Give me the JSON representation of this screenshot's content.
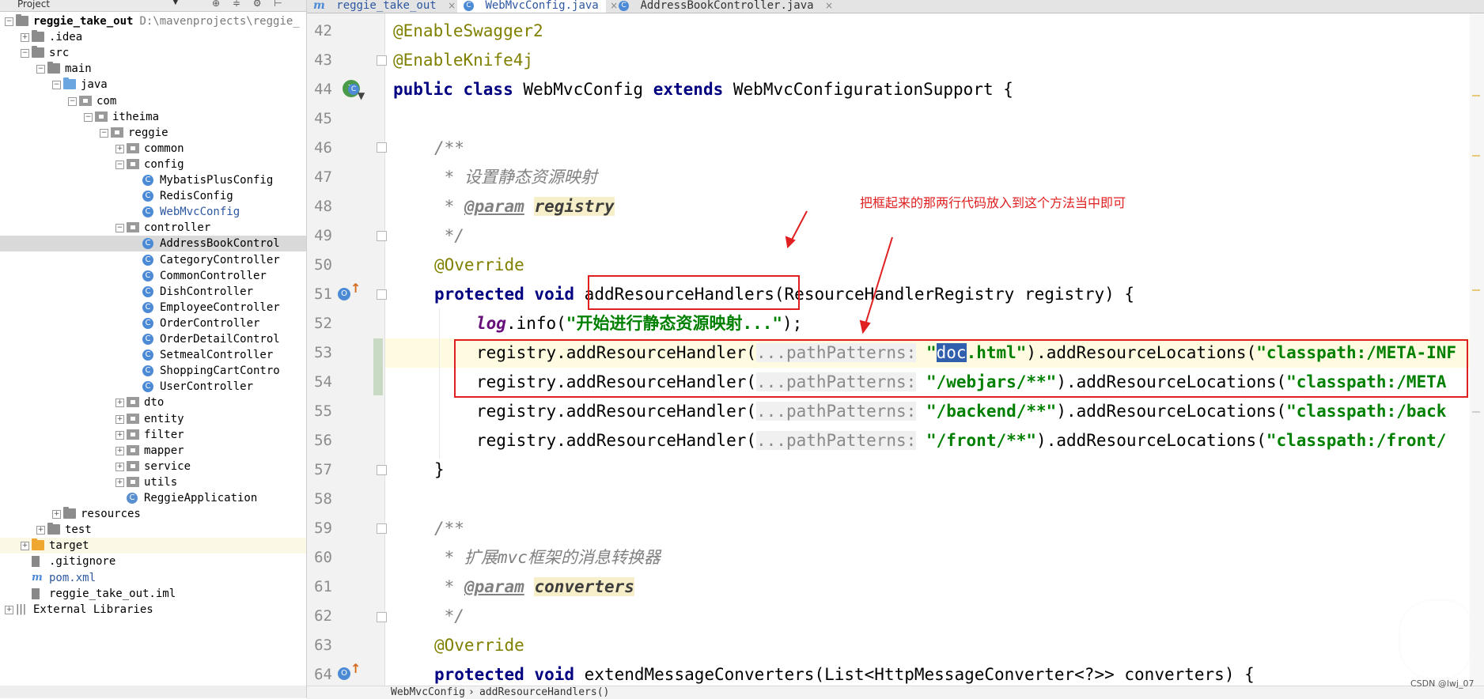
{
  "project_panel": {
    "title": "Project",
    "dropdown_glyph": "▼",
    "tools_glyphs": "⊕ ≑ ⚙ ⊢",
    "tree": [
      {
        "label": "reggie_take_out",
        "path": "D:\\mavenprojects\\reggie_",
        "bold": true,
        "icon": "folder-icon",
        "expander": "−",
        "depth": 0
      },
      {
        "label": ".idea",
        "icon": "folder-icon",
        "expander": "+",
        "depth": 1
      },
      {
        "label": "src",
        "icon": "folder-icon",
        "expander": "−",
        "depth": 1
      },
      {
        "label": "main",
        "icon": "folder-icon",
        "expander": "−",
        "depth": 2
      },
      {
        "label": "java",
        "icon": "source-folder-icon",
        "expander": "−",
        "depth": 3
      },
      {
        "label": "com",
        "icon": "package-icon",
        "expander": "−",
        "depth": 4
      },
      {
        "label": "itheima",
        "icon": "package-icon",
        "expander": "−",
        "depth": 5
      },
      {
        "label": "reggie",
        "icon": "package-icon",
        "expander": "−",
        "depth": 6
      },
      {
        "label": "common",
        "icon": "package-icon",
        "expander": "+",
        "depth": 7
      },
      {
        "label": "config",
        "icon": "package-icon",
        "expander": "−",
        "depth": 7
      },
      {
        "label": "MybatisPlusConfig",
        "icon": "class-icon",
        "depth": 8
      },
      {
        "label": "RedisConfig",
        "icon": "class-icon",
        "depth": 8
      },
      {
        "label": "WebMvcConfig",
        "icon": "class-icon",
        "depth": 8,
        "blue": true
      },
      {
        "label": "controller",
        "icon": "package-icon",
        "expander": "−",
        "depth": 7
      },
      {
        "label": "AddressBookControl",
        "icon": "class-icon",
        "depth": 8,
        "selected": true
      },
      {
        "label": "CategoryController",
        "icon": "class-icon",
        "depth": 8
      },
      {
        "label": "CommonController",
        "icon": "class-icon",
        "depth": 8
      },
      {
        "label": "DishController",
        "icon": "class-icon",
        "depth": 8
      },
      {
        "label": "EmployeeController",
        "icon": "class-icon",
        "depth": 8
      },
      {
        "label": "OrderController",
        "icon": "class-icon",
        "depth": 8
      },
      {
        "label": "OrderDetailControl",
        "icon": "class-icon",
        "depth": 8
      },
      {
        "label": "SetmealController",
        "icon": "class-icon",
        "depth": 8
      },
      {
        "label": "ShoppingCartContro",
        "icon": "class-icon",
        "depth": 8
      },
      {
        "label": "UserController",
        "icon": "class-icon",
        "depth": 8
      },
      {
        "label": "dto",
        "icon": "package-icon",
        "expander": "+",
        "depth": 7
      },
      {
        "label": "entity",
        "icon": "package-icon",
        "expander": "+",
        "depth": 7
      },
      {
        "label": "filter",
        "icon": "package-icon",
        "expander": "+",
        "depth": 7
      },
      {
        "label": "mapper",
        "icon": "package-icon",
        "expander": "+",
        "depth": 7
      },
      {
        "label": "service",
        "icon": "package-icon",
        "expander": "+",
        "depth": 7
      },
      {
        "label": "utils",
        "icon": "package-icon",
        "expander": "+",
        "depth": 7
      },
      {
        "label": "ReggieApplication",
        "icon": "spring-class-icon",
        "depth": 7
      },
      {
        "label": "resources",
        "icon": "folder-icon",
        "expander": "+",
        "depth": 3
      },
      {
        "label": "test",
        "icon": "folder-icon",
        "expander": "+",
        "depth": 2
      },
      {
        "label": "target",
        "icon": "excluded-folder-icon",
        "expander": "+",
        "depth": 1,
        "highlight": true
      },
      {
        "label": ".gitignore",
        "icon": "file-icon",
        "depth": 1
      },
      {
        "label": "pom.xml",
        "icon": "maven-icon",
        "depth": 1,
        "blue": true
      },
      {
        "label": "reggie_take_out.iml",
        "icon": "file-icon",
        "depth": 1
      },
      {
        "label": "External Libraries",
        "icon": "libraries-icon",
        "expander": "+",
        "depth": 0
      }
    ]
  },
  "tabs": [
    {
      "label": "reggie_take_out",
      "icon": "maven-icon",
      "close": "×",
      "active": false
    },
    {
      "label": "WebMvcConfig.java",
      "icon": "class-icon",
      "close": "×",
      "active": true
    },
    {
      "label": "AddressBookController.java",
      "icon": "class-icon",
      "close": "×",
      "active": false
    }
  ],
  "editor": {
    "line_numbers": [
      "42",
      "43",
      "44",
      "45",
      "46",
      "47",
      "48",
      "49",
      "50",
      "51",
      "52",
      "53",
      "54",
      "55",
      "56",
      "57",
      "58",
      "59",
      "60",
      "61",
      "62",
      "63",
      "64"
    ],
    "lines": {
      "l42": "@EnableSwagger2",
      "l43": "@EnableKnife4j",
      "l44_kw1": "public class",
      "l44_name": " WebMvcConfig ",
      "l44_kw2": "extends",
      "l44_rest": " WebMvcConfigurationSupport {",
      "l46": "/**",
      "l47": " * 设置静态资源映射",
      "l48_pre": " * ",
      "l48_tag": "@param",
      "l48_param": "registry",
      "l49": " */",
      "l50": "@Override",
      "l51_kw": "protected void",
      "l51_method": "addResourceHandlers",
      "l51_rest": "(ResourceHandlerRegistry registry) {",
      "l52_field": "log",
      "l52_mid": ".info(",
      "l52_str": "\"开始进行静态资源映射...\"",
      "l52_end": ");",
      "reg_prefix": "registry.addResourceHandler(",
      "hint": "...pathPatterns:",
      "l53_q": "\"",
      "l53_sel": "doc",
      "l53_str_rest": ".html\"",
      "l53_rest": ").addResourceLocations(",
      "l53_loc": "\"classpath:/META-INF",
      "l54_str": "\"/webjars/**\"",
      "l54_rest": ").addResourceLocations(",
      "l54_loc": "\"classpath:/META",
      "l55_str": "\"/backend/**\"",
      "l55_rest": ").addResourceLocations(",
      "l55_loc": "\"classpath:/back",
      "l56_str": "\"/front/**\"",
      "l56_rest": ").addResourceLocations(",
      "l56_loc": "\"classpath:/front/",
      "l57": "}",
      "l59": "/**",
      "l60": " * 扩展mvc框架的消息转换器",
      "l61_pre": " * ",
      "l61_tag": "@param",
      "l61_param": "converters",
      "l62": " */",
      "l63": "@Override",
      "l64_kw": "protected void",
      "l64_rest": " extendMessageConverters(List<HttpMessageConverter<?>> converters) {"
    }
  },
  "annotation_note": "把框起来的那两行代码放入到这个方法当中即可",
  "breadcrumb": {
    "class": "WebMvcConfig",
    "sep": "›",
    "method": "addResourceHandlers()"
  },
  "watermark": "CSDN @lwj_07",
  "colors": {
    "annotation_red": "#e02020",
    "selection": "#2f5fad",
    "keyword": "#000080"
  }
}
